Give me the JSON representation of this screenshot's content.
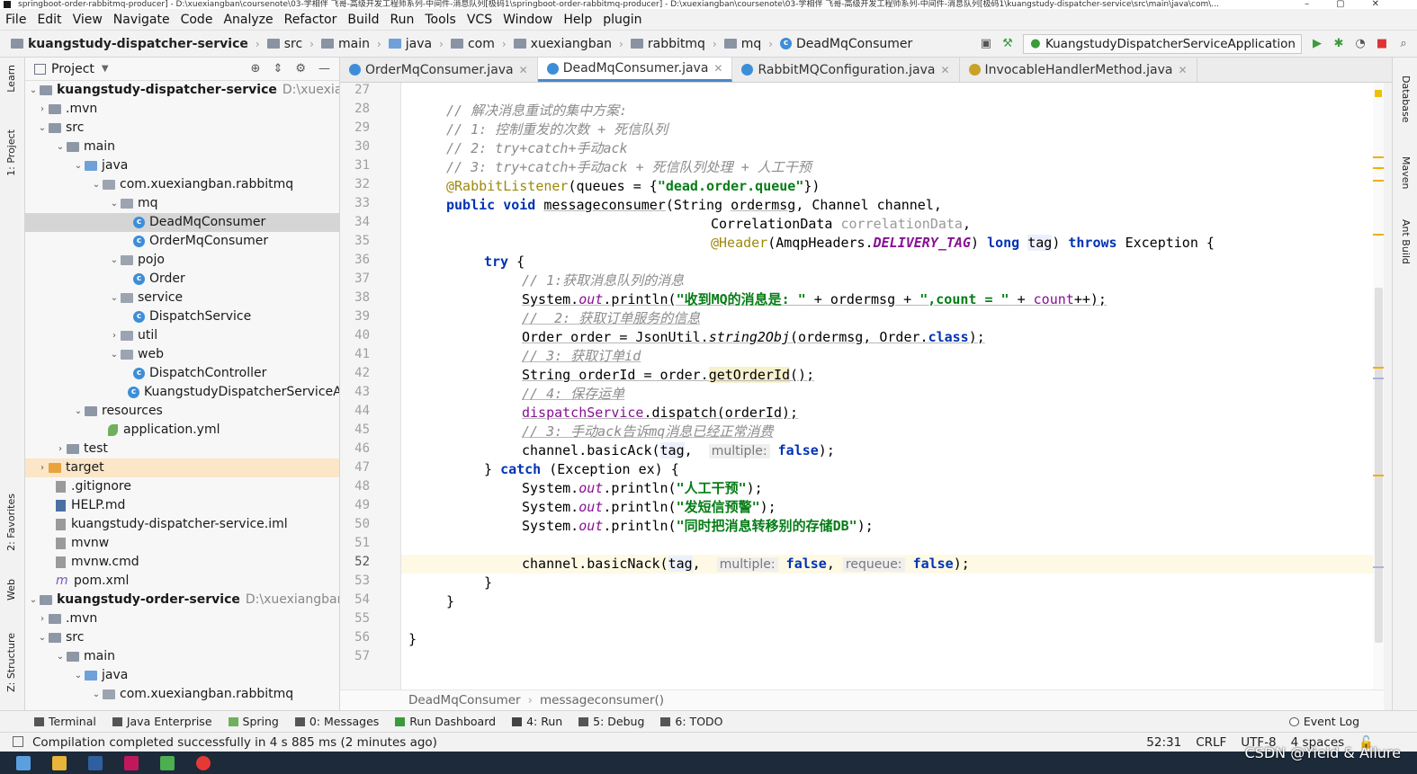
{
  "window": {
    "title": "springboot-order-rabbitmq-producer] - D:\\xuexiangban\\coursenote\\03-学相伴 飞哥-高级开发工程师系列-中间件-消息队列[极码1\\springboot-order-rabbitmq-producer] - D:\\xuexiangban\\coursenote\\03-学相伴 飞哥-高级开发工程师系列-中间件-消息队列[极码1\\kuangstudy-dispatcher-service\\src\\main\\java\\com\\..."
  },
  "menu": [
    "File",
    "Edit",
    "View",
    "Navigate",
    "Code",
    "Analyze",
    "Refactor",
    "Build",
    "Run",
    "Tools",
    "VCS",
    "Window",
    "Help",
    "plugin"
  ],
  "nav": {
    "crumbs": [
      "kuangstudy-dispatcher-service",
      "src",
      "main",
      "java",
      "com",
      "xuexiangban",
      "rabbitmq",
      "mq",
      "DeadMqConsumer"
    ],
    "run_config": "KuangstudyDispatcherServiceApplication"
  },
  "left_tools": [
    "1: Project",
    "2: Favorites",
    "Web",
    "Z: Structure",
    "Learn"
  ],
  "right_tools": [
    "Database",
    "Maven",
    "Ant Build"
  ],
  "project_panel": {
    "title": "Project",
    "tree": [
      {
        "label": "kuangstudy-dispatcher-service",
        "path": "D:\\xuexiangban\\c",
        "bold": true
      },
      {
        "label": ".mvn"
      },
      {
        "label": "src"
      },
      {
        "label": "main"
      },
      {
        "label": "java"
      },
      {
        "label": "com.xuexiangban.rabbitmq"
      },
      {
        "label": "mq"
      },
      {
        "label": "DeadMqConsumer"
      },
      {
        "label": "OrderMqConsumer"
      },
      {
        "label": "pojo"
      },
      {
        "label": "Order"
      },
      {
        "label": "service"
      },
      {
        "label": "DispatchService"
      },
      {
        "label": "util"
      },
      {
        "label": "web"
      },
      {
        "label": "DispatchController"
      },
      {
        "label": "KuangstudyDispatcherServiceApplic"
      },
      {
        "label": "resources"
      },
      {
        "label": "application.yml"
      },
      {
        "label": "test"
      },
      {
        "label": "target"
      },
      {
        "label": ".gitignore"
      },
      {
        "label": "HELP.md"
      },
      {
        "label": "kuangstudy-dispatcher-service.iml"
      },
      {
        "label": "mvnw"
      },
      {
        "label": "mvnw.cmd"
      },
      {
        "label": "pom.xml"
      },
      {
        "label": "kuangstudy-order-service",
        "path": "D:\\xuexiangban\\course",
        "bold": true
      },
      {
        "label": ".mvn"
      },
      {
        "label": "src"
      },
      {
        "label": "main"
      },
      {
        "label": "java"
      },
      {
        "label": "com.xuexiangban.rabbitmq"
      }
    ]
  },
  "tabs": [
    "OrderMqConsumer.java",
    "DeadMqConsumer.java",
    "RabbitMQConfiguration.java",
    "InvocableHandlerMethod.java"
  ],
  "active_tab": "DeadMqConsumer.java",
  "editor": {
    "line_numbers": [
      "27",
      "28",
      "29",
      "30",
      "31",
      "32",
      "33",
      "34",
      "35",
      "36",
      "37",
      "38",
      "39",
      "40",
      "41",
      "42",
      "43",
      "44",
      "45",
      "46",
      "47",
      "48",
      "49",
      "50",
      "51",
      "52",
      "53",
      "54",
      "55",
      "56",
      "57"
    ],
    "current_line": "52",
    "comments": {
      "l28": "// 解决消息重试的集中方案:",
      "l29": "// 1: 控制重发的次数 + 死信队列",
      "l30": "// 2: try+catch+手动ack",
      "l31": "// 3: try+catch+手动ack + 死信队列处理 + 人工干预",
      "l37": "// 1:获取消息队列的消息",
      "l39": "//  2: 获取订单服务的信息",
      "l41": "// 3: 获取订单id",
      "l43": "// 4: 保存运单",
      "l45": "// 3: 手动ack告诉mq消息已经正常消费"
    },
    "strings": {
      "queue": "\"dead.order.queue\"",
      "received": "\"收到MQ的消息是: \"",
      "count": "\",count = \"",
      "manual": "\"人工干预\"",
      "sms": "\"发短信预警\"",
      "db": "\"同时把消息转移别的存储DB\""
    },
    "hints": {
      "multiple": "multiple:",
      "requeue": "requeue:"
    }
  },
  "editor_breadcrumb": [
    "DeadMqConsumer",
    "messageconsumer()"
  ],
  "tool_windows": [
    "Terminal",
    "Java Enterprise",
    "Spring",
    "0: Messages",
    "Run Dashboard",
    "4: Run",
    "5: Debug",
    "6: TODO"
  ],
  "event_log": "Event Log",
  "status": {
    "message": "Compilation completed successfully in 4 s 885 ms (2 minutes ago)",
    "position": "52:31",
    "line_sep": "CRLF",
    "encoding": "UTF-8",
    "indent": "4 spaces"
  },
  "watermark": "CSDN @Yield & Allure",
  "colors": {
    "keyword": "#0033b3",
    "string": "#067d17",
    "comment": "#8c8c8c",
    "annotation": "#9e880d",
    "field": "#871094",
    "accent": "#4a88c7"
  }
}
